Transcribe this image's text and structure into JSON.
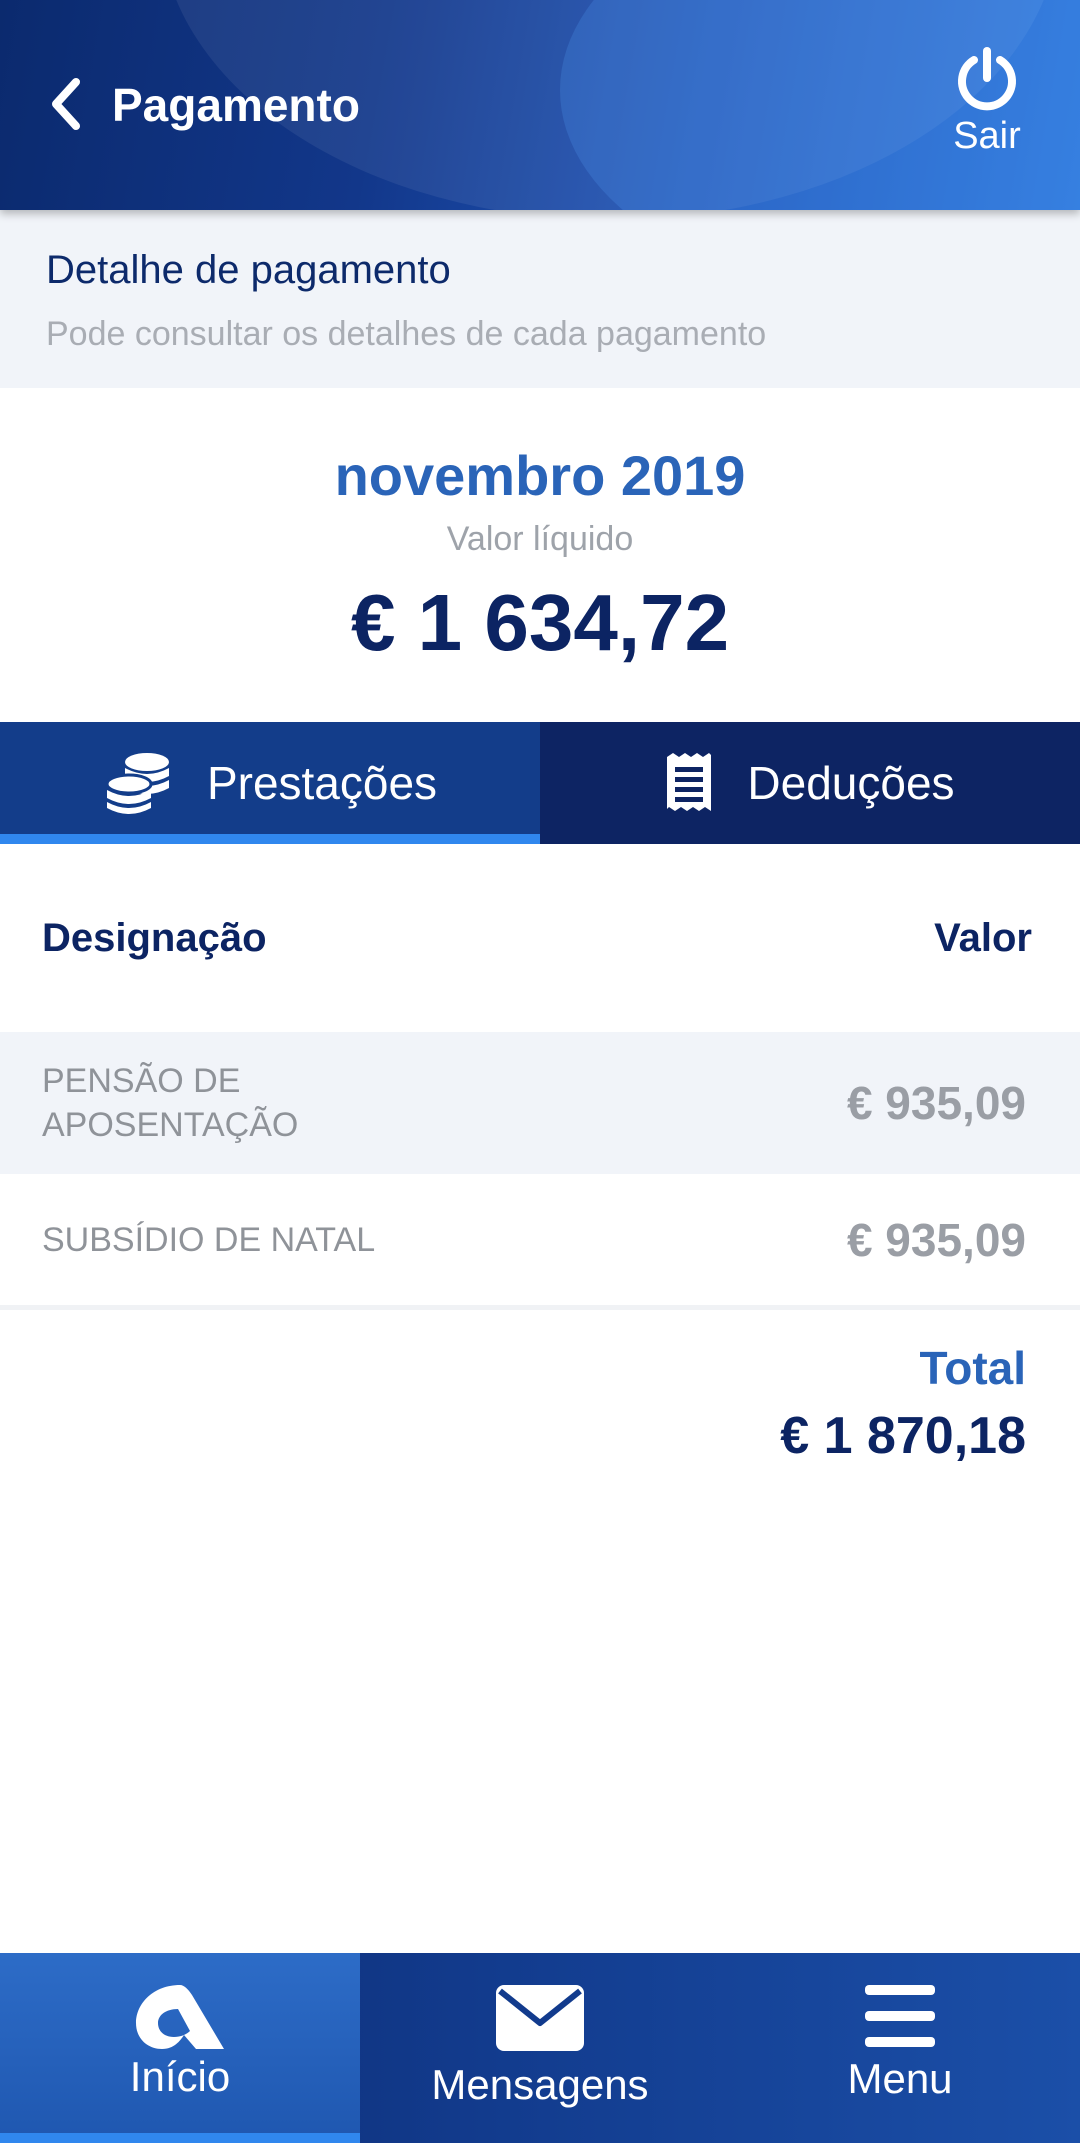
{
  "header": {
    "title": "Pagamento",
    "logout_label": "Sair"
  },
  "info": {
    "title": "Detalhe de pagamento",
    "subtitle": "Pode consultar os detalhes de cada pagamento"
  },
  "summary": {
    "period": "novembro 2019",
    "net_label": "Valor líquido",
    "net_value": "€ 1 634,72"
  },
  "tabs": [
    {
      "label": "Prestações",
      "icon": "coins-icon",
      "active": true
    },
    {
      "label": "Deduções",
      "icon": "receipt-icon",
      "active": false
    }
  ],
  "table": {
    "col_designation": "Designação",
    "col_value": "Valor",
    "rows": [
      {
        "label": "PENSÃO DE APOSENTAÇÃO",
        "value": "€ 935,09"
      },
      {
        "label": "SUBSÍDIO DE NATAL",
        "value": "€ 935,09"
      }
    ],
    "total_label": "Total",
    "total_value": "€ 1 870,18"
  },
  "bottom_nav": [
    {
      "label": "Início",
      "icon": "home-logo-icon",
      "active": true
    },
    {
      "label": "Mensagens",
      "icon": "envelope-icon",
      "active": false
    },
    {
      "label": "Menu",
      "icon": "hamburger-menu-icon",
      "active": false
    }
  ],
  "colors": {
    "primary_dark": "#0c2463",
    "accent_blue": "#2a64b8",
    "tab_indicator": "#3087ee"
  }
}
